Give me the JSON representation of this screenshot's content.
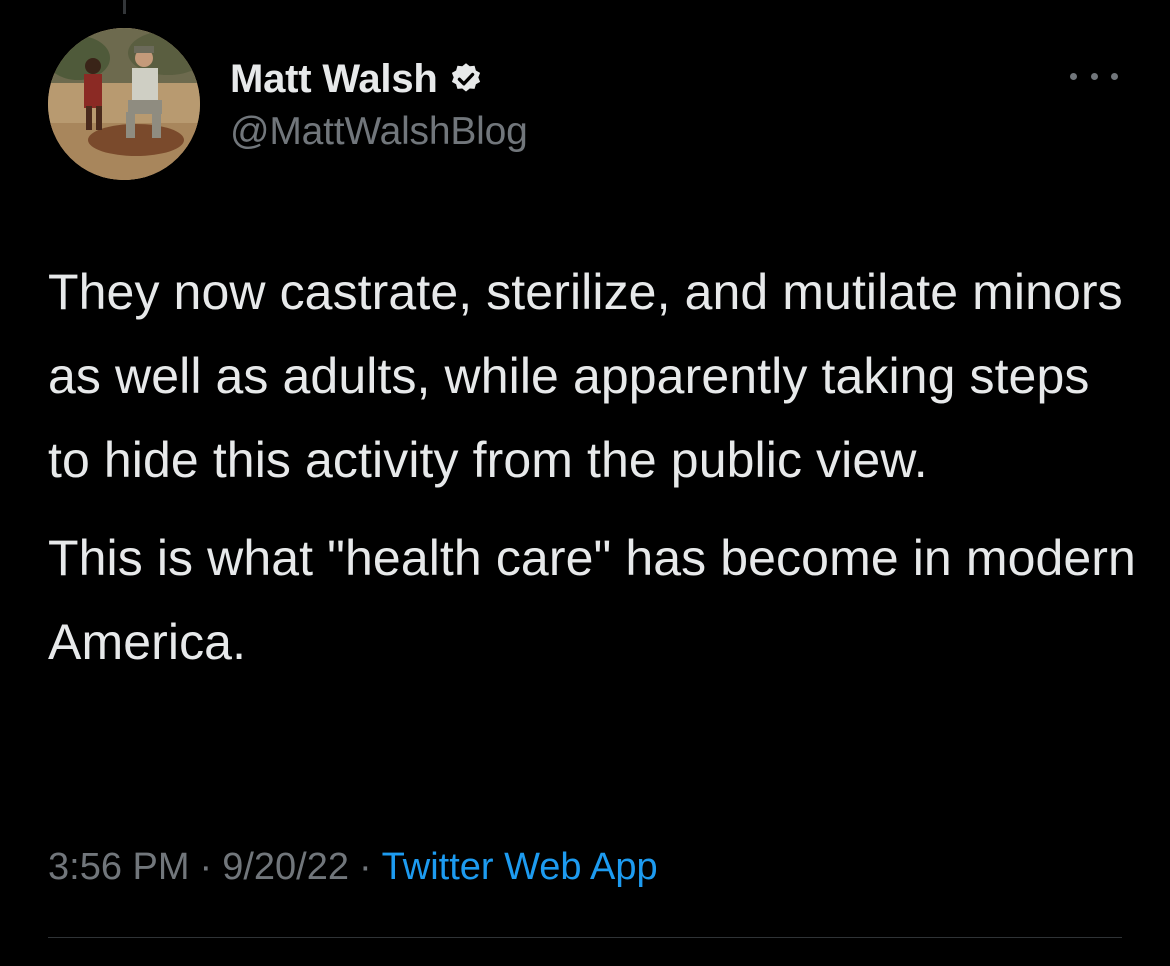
{
  "tweet": {
    "author": {
      "display_name": "Matt Walsh",
      "handle": "@MattWalshBlog",
      "verified": true,
      "avatar_icon": "avatar-photo-icon"
    },
    "more_icon": "more-options-icon",
    "paragraphs": [
      "They now castrate, sterilize, and mutilate minors as well as adults, while apparently taking steps to hide this activity from the public view.",
      "This is what \"health care\" has become in modern America."
    ],
    "meta": {
      "time": "3:56 PM",
      "separator": "·",
      "date": "9/20/22",
      "source": "Twitter Web App"
    }
  },
  "colors": {
    "background": "#000000",
    "text_primary": "#e7e9ea",
    "text_secondary": "#71767b",
    "link": "#1d9bf0",
    "divider": "#2f3336"
  }
}
